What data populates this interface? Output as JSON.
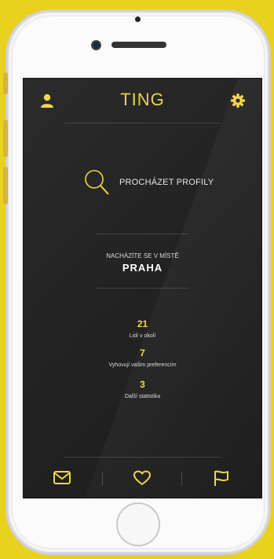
{
  "app": {
    "logo_text": "TING"
  },
  "colors": {
    "accent": "#e8d24a",
    "background": "#e8d21d",
    "screen": "#232323"
  },
  "header": {
    "left_icon": "user-icon",
    "right_icon": "gear-icon"
  },
  "browse": {
    "icon": "search-icon",
    "label": "PROCHÁZET PROFILY"
  },
  "location": {
    "caption": "NACHÁZÍTE SE V MÍSTĚ",
    "city": "PRAHA"
  },
  "stats": [
    {
      "value": "21",
      "label": "Lidí v okolí"
    },
    {
      "value": "7",
      "label": "Vyhovují vašim preferencím"
    },
    {
      "value": "3",
      "label": "Další statistika"
    }
  ],
  "tabbar": {
    "icons": [
      "mail-icon",
      "heart-icon",
      "flag-icon"
    ]
  }
}
